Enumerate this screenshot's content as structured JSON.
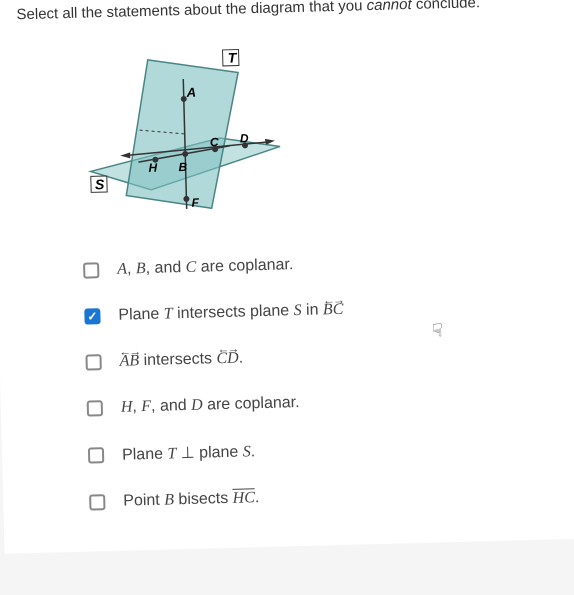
{
  "question": {
    "prefix": "Select all the statements about the diagram that you ",
    "emphasis": "cannot",
    "suffix": " conclude."
  },
  "diagram": {
    "labels": {
      "T": "T",
      "A": "A",
      "S": "S",
      "H": "H",
      "B": "B",
      "C": "C",
      "D": "D",
      "F": "F"
    }
  },
  "options": [
    {
      "checked": false,
      "parts": [
        "A",
        ", ",
        "B",
        ", and ",
        "C",
        " are coplanar."
      ]
    },
    {
      "checked": true,
      "parts": [
        "Plane ",
        "T",
        " intersects plane ",
        "S",
        " in "
      ],
      "line": "BC"
    },
    {
      "checked": false,
      "line1": "AB",
      "middle": " intersects ",
      "line2": "CD",
      "suffix": "."
    },
    {
      "checked": false,
      "parts": [
        "H",
        ", ",
        "F",
        ", and ",
        "D",
        " are coplanar."
      ]
    },
    {
      "checked": false,
      "parts": [
        "Plane ",
        "T",
        " ⊥ plane ",
        "S",
        "."
      ]
    },
    {
      "checked": false,
      "parts": [
        "Point ",
        "B",
        " bisects "
      ],
      "segment": "HC",
      "suffix": "."
    }
  ]
}
